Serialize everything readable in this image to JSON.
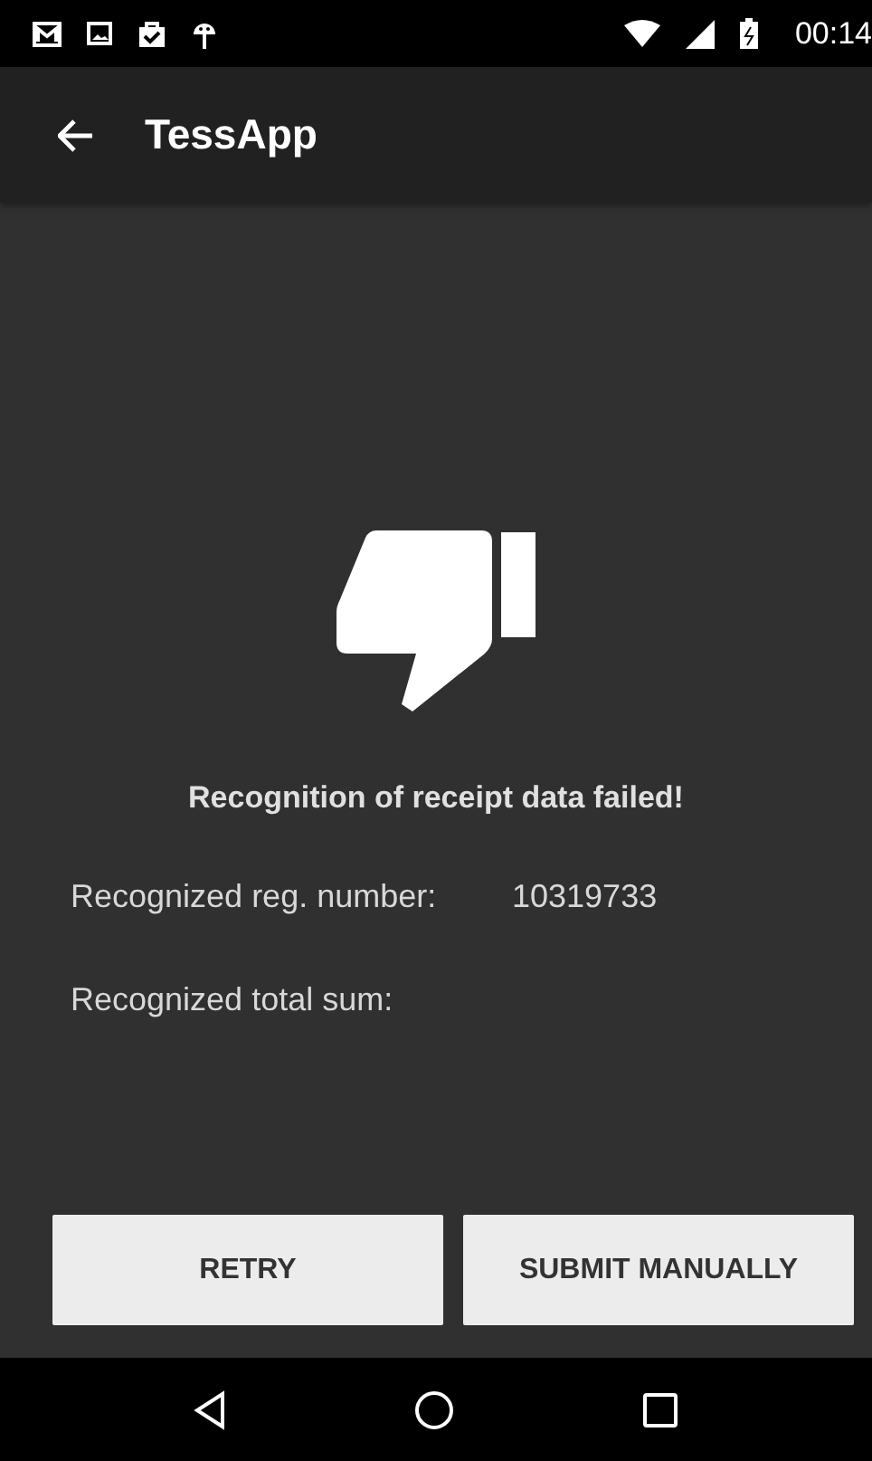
{
  "status_bar": {
    "time": "00:14"
  },
  "app_bar": {
    "title": "TessApp"
  },
  "message": "Recognition of receipt data failed!",
  "fields": [
    {
      "label": "Recognized reg. number:",
      "value": "10319733"
    },
    {
      "label": "Recognized total sum:"
    }
  ],
  "buttons": [
    "RETRY",
    "SUBMIT MANUALLY"
  ]
}
